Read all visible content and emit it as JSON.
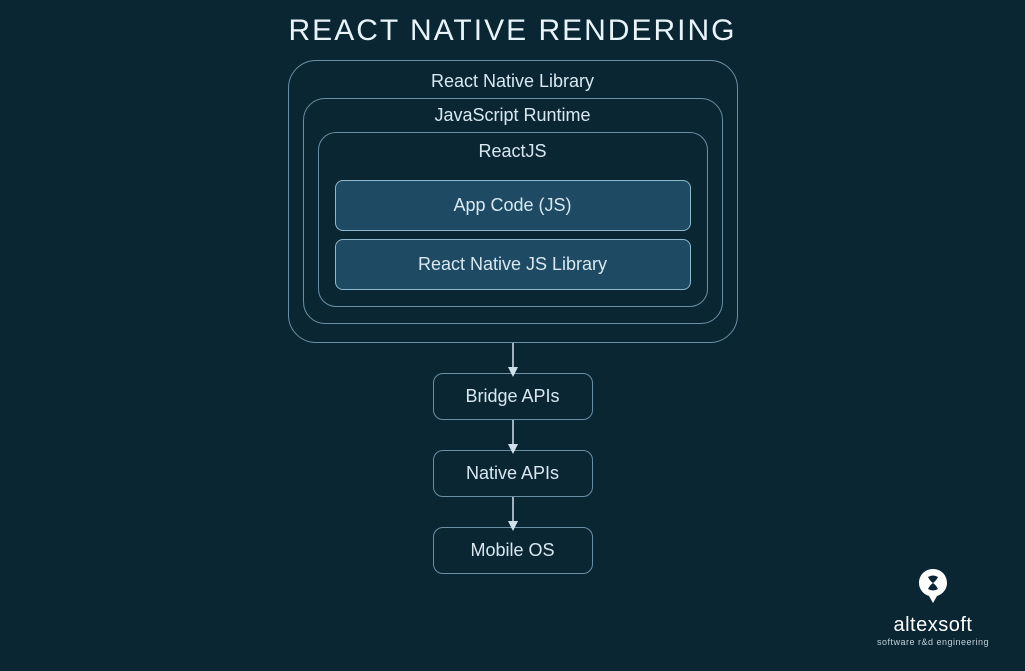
{
  "title": "REACT NATIVE RENDERING",
  "layers": {
    "outer": "React Native Library",
    "mid": "JavaScript Runtime",
    "inner": "ReactJS",
    "box1": "App Code (JS)",
    "box2": "React Native JS Library"
  },
  "flow": {
    "bridge": "Bridge APIs",
    "native": "Native APIs",
    "os": "Mobile OS"
  },
  "logo": {
    "brand": "altexsoft",
    "tagline": "software r&d engineering"
  },
  "colors": {
    "bg": "#0a2633",
    "stroke": "#6a8fa5",
    "fill": "#1e4a63"
  }
}
